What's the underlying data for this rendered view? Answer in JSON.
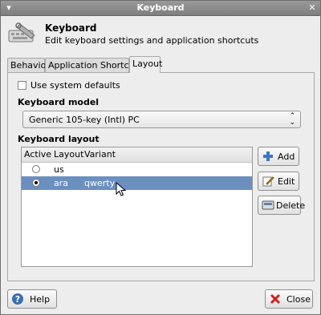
{
  "window": {
    "title": "Keyboard"
  },
  "header": {
    "title": "Keyboard",
    "subtitle": "Edit keyboard settings and application shortcuts"
  },
  "tabs": [
    {
      "label": "Behavior",
      "active": false
    },
    {
      "label": "Application Shortcuts",
      "active": false
    },
    {
      "label": "Layout",
      "active": true
    }
  ],
  "layout_tab": {
    "use_system_defaults": {
      "label": "Use system defaults",
      "checked": false
    },
    "keyboard_model": {
      "heading": "Keyboard model",
      "selected": "Generic 105-key (Intl) PC"
    },
    "keyboard_layout": {
      "heading": "Keyboard layout",
      "columns": [
        "Active",
        "Layout",
        "Variant"
      ],
      "rows": [
        {
          "active": false,
          "layout": "us",
          "variant": ""
        },
        {
          "active": true,
          "layout": "ara",
          "variant": "qwerty"
        }
      ]
    },
    "buttons": {
      "add": "Add",
      "edit": "Edit",
      "delete": "Delete"
    }
  },
  "footer": {
    "help": "Help",
    "close": "Close"
  },
  "colors": {
    "selection": "#6b8fbf",
    "titlebar": "#8a8a8a",
    "close_icon": "#d02020",
    "help_icon": "#3a6fb0",
    "add_icon": "#3a78c8"
  }
}
